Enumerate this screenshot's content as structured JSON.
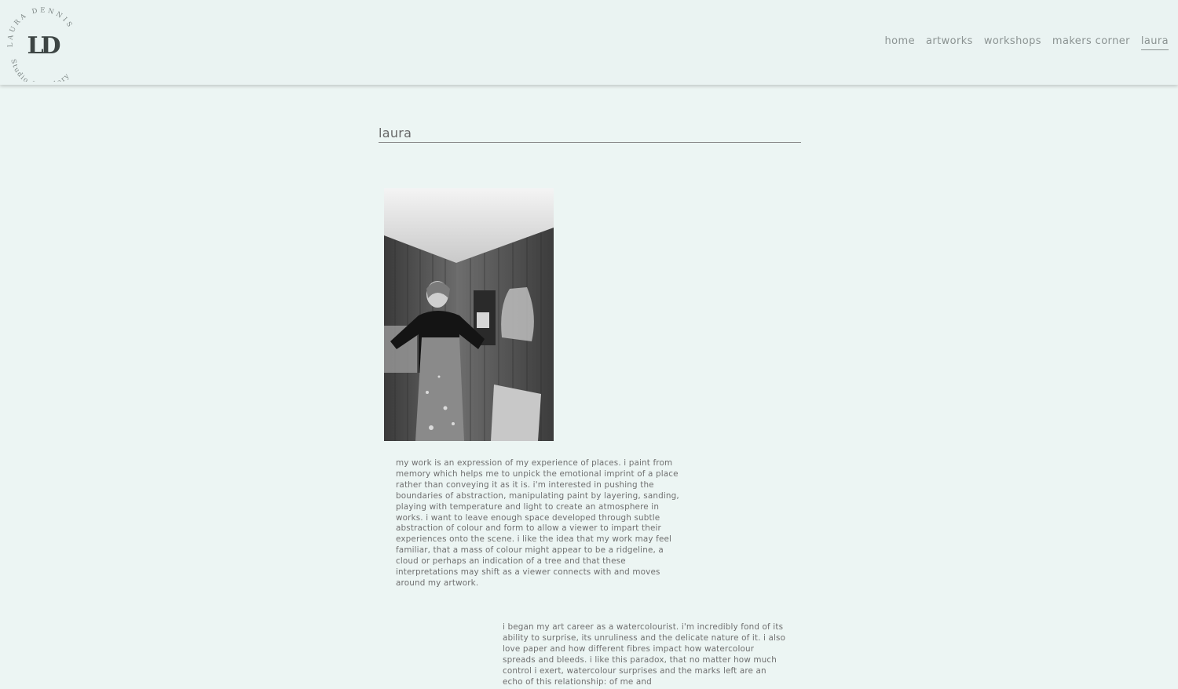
{
  "logo": {
    "monogram": "LD",
    "ring_top": "LAURA DENNIS",
    "ring_bottom": "Studio & Gallery"
  },
  "nav": {
    "items": [
      {
        "label": "home",
        "active": false
      },
      {
        "label": "artworks",
        "active": false
      },
      {
        "label": "workshops",
        "active": false
      },
      {
        "label": "makers corner",
        "active": false
      },
      {
        "label": "laura",
        "active": true
      }
    ]
  },
  "main": {
    "title": "laura",
    "bio_1": "my work is an expression of my experience of places. i paint from memory which helps me to unpick the emotional imprint of a place rather than conveying it as it is. i'm interested in pushing the boundaries of abstraction, manipulating paint by layering, sanding, playing with temperature and light to create an atmosphere in works. i want to leave enough space developed through subtle abstraction of colour and form to allow a viewer to impart their experiences onto the scene. i like the idea that my work may feel familiar, that a mass of colour might appear to be a ridgeline, a cloud or perhaps an indication of a tree and that these interpretations may shift as a viewer connects with and moves around my artwork.",
    "bio_2": "i began my art career as a watercolourist. i'm incredibly fond of its ability to surprise, its unruliness and the delicate nature of it. i also love paper and how different fibres impact how watercolour spreads and bleeds. i like this paradox, that no matter how much control i exert, watercolour surprises and the marks left are an echo of this relationship: of me and"
  },
  "colors": {
    "background": "#ecf5f3",
    "header": "#eaf3f2",
    "nav_text": "#8b9392",
    "body_text": "#6f6f6f"
  }
}
